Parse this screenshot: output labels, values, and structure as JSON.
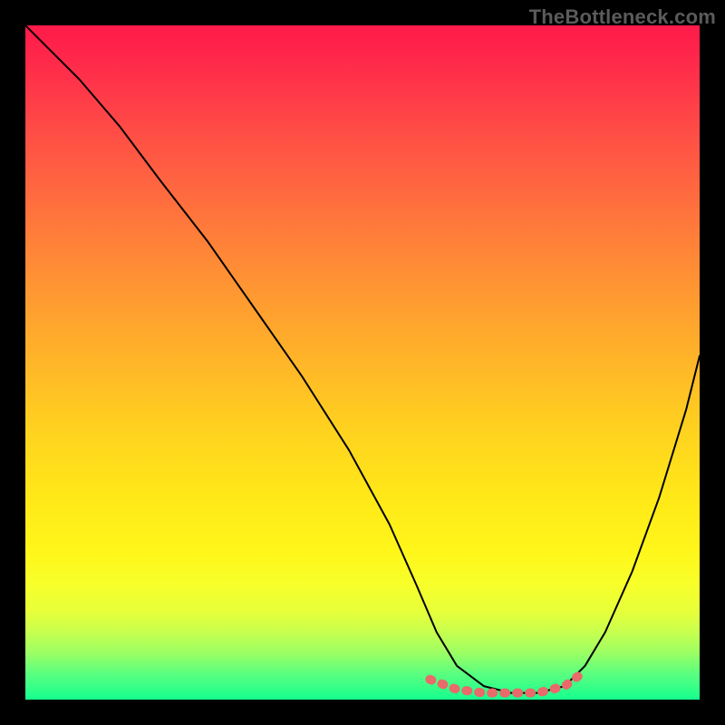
{
  "watermark": "TheBottleneck.com",
  "colors": {
    "curve_stroke": "#000000",
    "marker_stroke": "#e86a6a",
    "background_frame": "#000000"
  },
  "chart_data": {
    "type": "line",
    "title": "",
    "xlabel": "",
    "ylabel": "",
    "xlim": [
      0,
      100
    ],
    "ylim": [
      0,
      100
    ],
    "grid": false,
    "legend": false,
    "description": "Bottleneck percentage curve over a rainbow gradient background (red = high bottleneck, green = low). Curve descends from top-left, reaches a flat minimum around x 60–80, then rises toward the right edge. The flat minimum segment is highlighted with a dashed salmon marker.",
    "series": [
      {
        "name": "bottleneck_curve",
        "x": [
          0,
          3,
          8,
          14,
          20,
          27,
          34,
          41,
          48,
          54,
          58,
          61,
          64,
          68,
          72,
          76,
          80,
          83,
          86,
          90,
          94,
          98,
          100
        ],
        "y": [
          100,
          97,
          92,
          85,
          77,
          68,
          58,
          48,
          37,
          26,
          17,
          10,
          5,
          2,
          1,
          1,
          2,
          5,
          10,
          19,
          30,
          43,
          51
        ]
      }
    ],
    "optimal_range_marker": {
      "x": [
        60,
        64,
        68,
        72,
        76,
        80,
        82
      ],
      "y": [
        3,
        1.5,
        1,
        1,
        1,
        2,
        3.5
      ]
    }
  }
}
